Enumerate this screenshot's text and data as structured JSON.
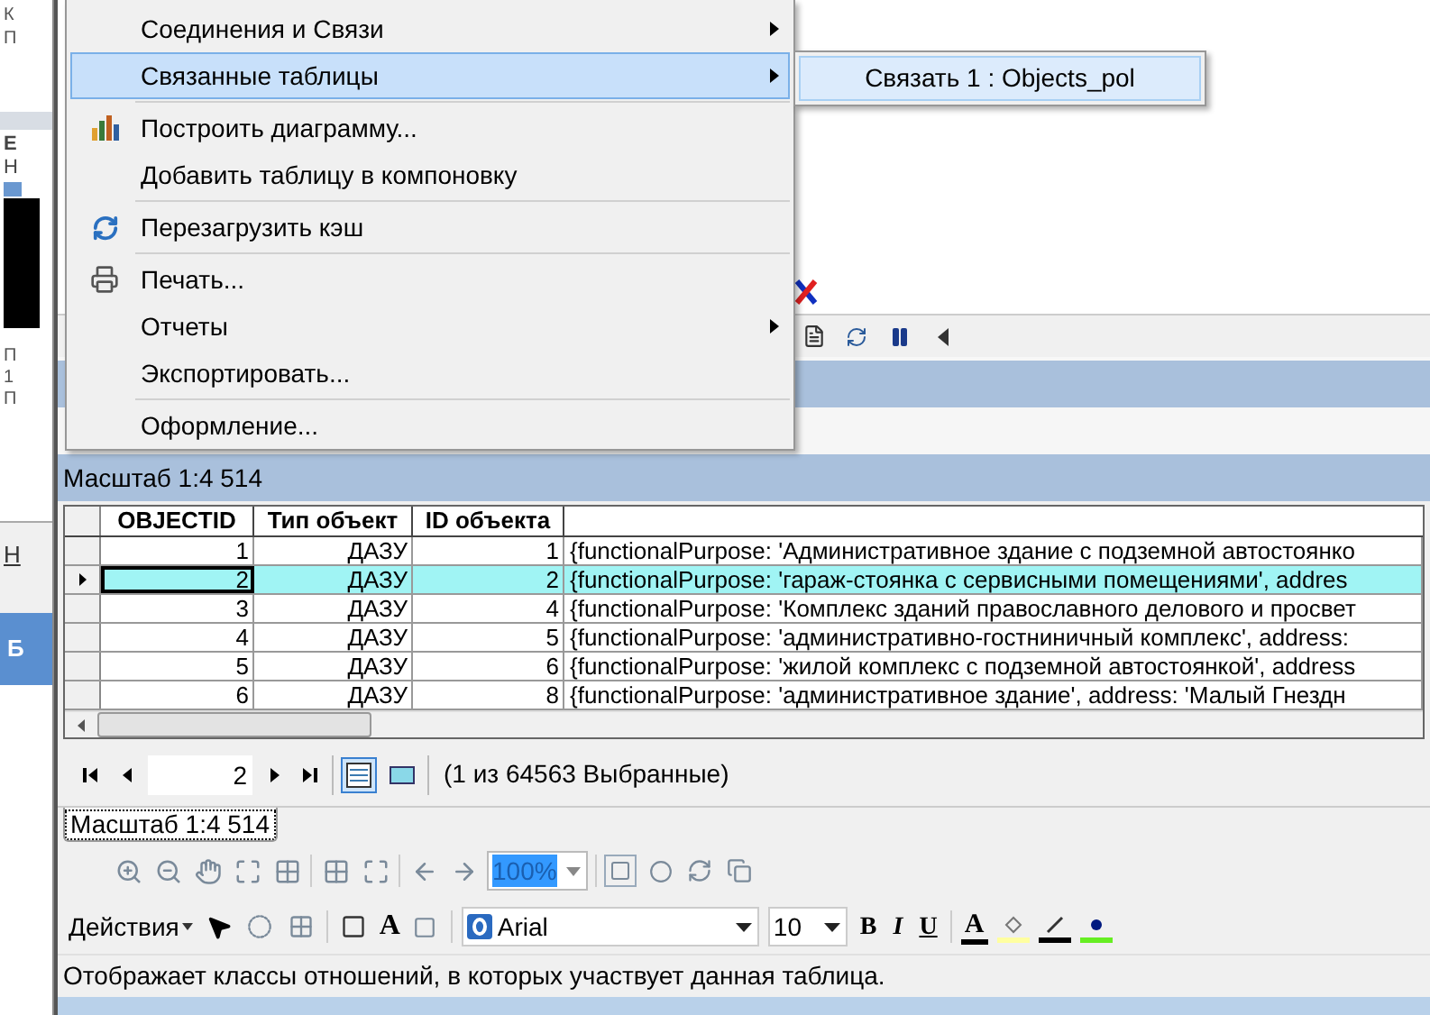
{
  "left_panel": {
    "top_letters": [
      "К",
      "П"
    ],
    "middle_letters": [
      "Е",
      "Н"
    ],
    "lower_letters": [
      "П",
      "1",
      "П"
    ],
    "link_letter": "Н",
    "bar_letter": "Б"
  },
  "context_menu": {
    "groups": [
      {
        "items": [
          {
            "label": "Соединения и Связи",
            "kind": "plain",
            "submenu": true,
            "selected": false
          },
          {
            "label": "Связанные таблицы",
            "kind": "plain",
            "submenu": true,
            "selected": true
          }
        ]
      },
      {
        "items": [
          {
            "label": "Построить диаграмму...",
            "kind": "chart",
            "submenu": false,
            "selected": false
          },
          {
            "label": "Добавить таблицу в компоновку",
            "kind": "plain",
            "submenu": false,
            "selected": false
          }
        ]
      },
      {
        "items": [
          {
            "label": "Перезагрузить кэш",
            "kind": "refresh",
            "submenu": false,
            "selected": false
          }
        ]
      },
      {
        "items": [
          {
            "label": "Печать...",
            "kind": "print",
            "submenu": false,
            "selected": false
          },
          {
            "label": "Отчеты",
            "kind": "plain",
            "submenu": true,
            "selected": false
          },
          {
            "label": "Экспортировать...",
            "kind": "plain",
            "submenu": false,
            "selected": false
          }
        ]
      },
      {
        "items": [
          {
            "label": "Оформление...",
            "kind": "plain",
            "submenu": false,
            "selected": false
          }
        ]
      }
    ]
  },
  "submenu": {
    "items": [
      {
        "label": "Связать 1 : Objects_pol",
        "selected": true
      }
    ]
  },
  "table_window": {
    "title": "Масштаб 1:4 514"
  },
  "table": {
    "columns": [
      "OBJECTID",
      "Тип объект",
      "ID объекта"
    ],
    "rows": [
      {
        "selected": false,
        "cells": [
          "1",
          "ДАЗУ",
          "1",
          "{functionalPurpose: 'Административное здание с подземной автостоянко"
        ]
      },
      {
        "selected": true,
        "cells": [
          "2",
          "ДАЗУ",
          "2",
          "{functionalPurpose: 'гараж-стоянка с сервисными помещениями', addres"
        ]
      },
      {
        "selected": false,
        "cells": [
          "3",
          "ДАЗУ",
          "4",
          "{functionalPurpose: 'Комплекс зданий православного делового и просвет"
        ]
      },
      {
        "selected": false,
        "cells": [
          "4",
          "ДАЗУ",
          "5",
          "{functionalPurpose: 'административно-гостниничный комплекс', address:"
        ]
      },
      {
        "selected": false,
        "cells": [
          "5",
          "ДАЗУ",
          "6",
          "{functionalPurpose: 'жилой комплекс с подземной автостоянкой', address"
        ]
      },
      {
        "selected": false,
        "cells": [
          "6",
          "ДАЗУ",
          "8",
          "{functionalPurpose: 'административное здание', address: 'Малый Гнездн"
        ]
      }
    ]
  },
  "navigation": {
    "record": "2",
    "selection_info": "(1 из 64563 Выбранные)"
  },
  "tab": {
    "label": "Масштаб 1:4 514",
    "selected": true
  },
  "layout_toolbar": {
    "zoom": "100%"
  },
  "draw_toolbar": {
    "actions": "Действия",
    "text_tool": "A",
    "font": "Arial",
    "size": "10",
    "bold": "B",
    "italic": "I",
    "underline": "U",
    "font_color": "A"
  },
  "status_bar": "Отображает классы отношений, в которых участвует данная таблица."
}
